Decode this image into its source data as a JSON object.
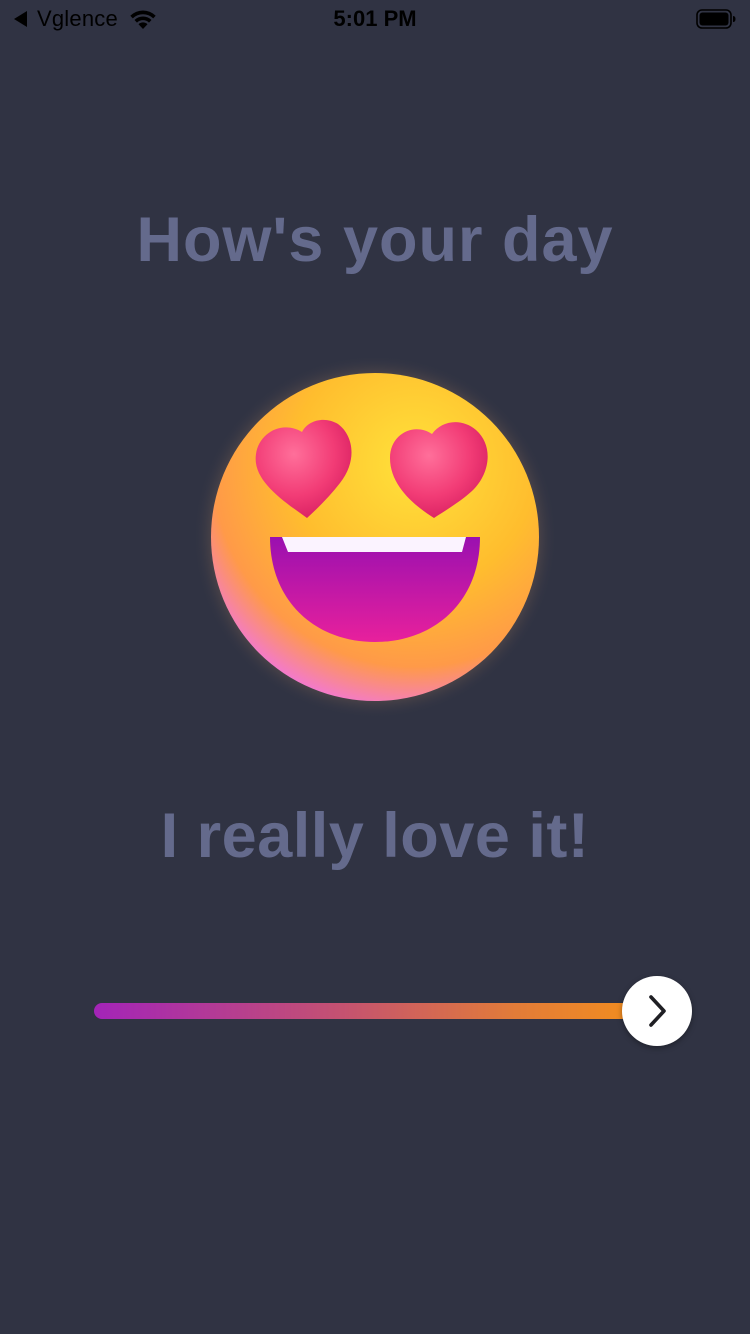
{
  "status_bar": {
    "back_app_label": "Vglence",
    "time": "5:01 PM",
    "icons": [
      "back-arrow-icon",
      "wifi-icon",
      "battery-icon"
    ]
  },
  "main": {
    "title": "How's your day",
    "emoji": "heart-eyes-emoji",
    "mood_label": "I really love it!"
  },
  "mood_slider": {
    "value": 1.0,
    "thumb_icon": "chevron-right-icon",
    "gradient_colors": [
      "#a324b8",
      "#c5536f",
      "#e27c38",
      "#f5901a"
    ]
  },
  "colors": {
    "background": "#303343",
    "text": "#646a8c",
    "thumb": "#ffffff"
  }
}
